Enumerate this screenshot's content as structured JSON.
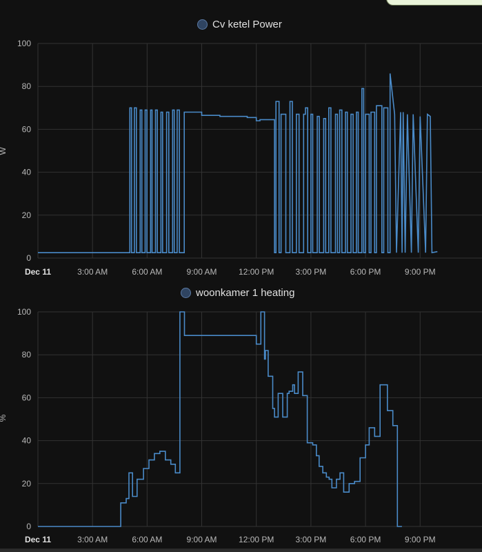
{
  "charts": [
    {
      "type": "line",
      "legend": "Cv ketel Power",
      "ylabel": "W",
      "ylim": [
        0,
        100
      ],
      "yticks": [
        "0",
        "20",
        "40",
        "60",
        "80",
        "100"
      ],
      "xlim": [
        0,
        24.4
      ],
      "xticks": [
        {
          "x": 0,
          "label": "Dec 11",
          "bold": true
        },
        {
          "x": 3,
          "label": "3:00 AM"
        },
        {
          "x": 6,
          "label": "6:00 AM"
        },
        {
          "x": 9,
          "label": "9:00 AM"
        },
        {
          "x": 12,
          "label": "12:00 PM"
        },
        {
          "x": 15,
          "label": "3:00 PM"
        },
        {
          "x": 18,
          "label": "6:00 PM"
        },
        {
          "x": 21,
          "label": "9:00 PM"
        }
      ],
      "color": "#4a8bc9",
      "series": {
        "x": [
          0.0,
          5.05,
          5.05,
          5.14,
          5.14,
          5.3,
          5.3,
          5.41,
          5.41,
          5.62,
          5.62,
          5.71,
          5.71,
          5.89,
          5.89,
          5.99,
          5.99,
          6.19,
          6.19,
          6.27,
          6.27,
          6.46,
          6.46,
          6.56,
          6.56,
          6.76,
          6.76,
          6.85,
          6.85,
          7.07,
          7.07,
          7.19,
          7.19,
          7.4,
          7.4,
          7.49,
          7.49,
          7.65,
          7.65,
          7.77,
          7.77,
          8.04,
          8.04,
          9.0,
          9.0,
          10.0,
          10.0,
          11.5,
          11.5,
          12.0,
          12.0,
          12.2,
          12.2,
          13.0,
          13.0,
          13.08,
          13.08,
          13.25,
          13.25,
          13.36,
          13.36,
          13.62,
          13.62,
          13.85,
          13.85,
          13.98,
          13.98,
          14.2,
          14.2,
          14.35,
          14.35,
          14.6,
          14.6,
          14.7,
          14.7,
          14.82,
          14.82,
          15.0,
          15.0,
          15.1,
          15.1,
          15.35,
          15.35,
          15.46,
          15.46,
          15.7,
          15.7,
          15.81,
          15.81,
          15.98,
          15.98,
          16.1,
          16.1,
          16.35,
          16.35,
          16.46,
          16.46,
          16.58,
          16.58,
          16.7,
          16.7,
          16.9,
          16.9,
          17.0,
          17.0,
          17.2,
          17.2,
          17.32,
          17.32,
          17.5,
          17.5,
          17.6,
          17.6,
          17.8,
          17.8,
          17.9,
          17.9,
          18.0,
          18.0,
          18.2,
          18.2,
          18.3,
          18.3,
          18.5,
          18.5,
          18.6,
          18.6,
          18.9,
          18.9,
          19.0,
          19.0,
          19.23,
          19.23,
          19.35,
          19.35,
          19.6,
          19.6,
          19.7,
          19.7,
          19.93,
          19.93,
          20.01,
          20.01,
          20.07,
          20.07,
          20.18,
          20.18,
          20.3,
          20.3,
          20.52,
          20.52,
          20.62,
          20.62,
          20.9,
          20.9,
          21.0,
          21.0,
          21.3,
          21.3,
          21.4,
          21.4,
          21.56,
          21.56,
          21.65,
          21.65,
          21.95,
          21.95,
          22.05,
          22.05,
          22.2,
          22.2,
          22.95,
          22.95,
          24.4
        ],
        "y": [
          2.5,
          2.5,
          70,
          70,
          2.5,
          2.5,
          70,
          70,
          2.5,
          2.5,
          69,
          69,
          2.5,
          2.5,
          69,
          69,
          2.5,
          2.5,
          69,
          69,
          2.5,
          2.5,
          69,
          69,
          2.5,
          2.5,
          68,
          68,
          2.5,
          2.5,
          68,
          68,
          2.5,
          2.5,
          69,
          69,
          2.5,
          2.5,
          69,
          69,
          2.5,
          2.5,
          68,
          68,
          66.5,
          66.5,
          66,
          66,
          65.5,
          65.5,
          64,
          64,
          64.5,
          64.5,
          2.5,
          2.5,
          73,
          73,
          2.5,
          2.5,
          67,
          67,
          2.5,
          2.5,
          73,
          73,
          2.5,
          2.5,
          67,
          67,
          2.5,
          2.5,
          67,
          67,
          70,
          70,
          2.5,
          2.5,
          67,
          67,
          2.5,
          2.5,
          66,
          66,
          2.5,
          2.5,
          65,
          65,
          2.5,
          2.5,
          70,
          70,
          2.5,
          2.5,
          67,
          67,
          2.5,
          2.5,
          69,
          69,
          2.5,
          2.5,
          68,
          68,
          2.5,
          2.5,
          67,
          67,
          2.5,
          2.5,
          68,
          68,
          2.5,
          2.5,
          79,
          79,
          2.5,
          2.5,
          67,
          67,
          2.5,
          2.5,
          68,
          68,
          2.5,
          2.5,
          71,
          71,
          2.5,
          2.5,
          70,
          70,
          2.5,
          2.5,
          86,
          67,
          67,
          2.5,
          2.5,
          68,
          68,
          2.5,
          2.5,
          68,
          68,
          2.5,
          2.5,
          67,
          67,
          2.5,
          2.5,
          67,
          67,
          2.5,
          2.5,
          66,
          66,
          2.5,
          2.5,
          67,
          67,
          66,
          66,
          2.5,
          2.5,
          3,
          3
        ]
      }
    },
    {
      "type": "line",
      "legend": "woonkamer 1 heating",
      "ylabel": "%",
      "ylim": [
        0,
        100
      ],
      "yticks": [
        "0",
        "20",
        "40",
        "60",
        "80",
        "100"
      ],
      "xlim": [
        0,
        24.4
      ],
      "xticks": [
        {
          "x": 0,
          "label": "Dec 11",
          "bold": true
        },
        {
          "x": 3,
          "label": "3:00 AM"
        },
        {
          "x": 6,
          "label": "6:00 AM"
        },
        {
          "x": 9,
          "label": "9:00 AM"
        },
        {
          "x": 12,
          "label": "12:00 PM"
        },
        {
          "x": 15,
          "label": "3:00 PM"
        },
        {
          "x": 18,
          "label": "6:00 PM"
        },
        {
          "x": 21,
          "label": "9:00 PM"
        }
      ],
      "color": "#4a8bc9",
      "series": {
        "x": [
          0.0,
          4.55,
          4.55,
          4.85,
          4.85,
          5.0,
          5.0,
          5.2,
          5.2,
          5.45,
          5.45,
          5.8,
          5.8,
          6.1,
          6.1,
          6.4,
          6.4,
          6.7,
          6.7,
          7.0,
          7.0,
          7.3,
          7.3,
          7.55,
          7.55,
          7.8,
          7.8,
          8.05,
          8.05,
          12.0,
          12.0,
          12.25,
          12.25,
          12.45,
          12.45,
          12.5,
          12.5,
          12.65,
          12.65,
          12.9,
          12.9,
          13.0,
          13.0,
          13.2,
          13.2,
          13.45,
          13.45,
          13.7,
          13.7,
          13.8,
          13.8,
          14.0,
          14.0,
          14.1,
          14.1,
          14.3,
          14.3,
          14.55,
          14.55,
          14.8,
          14.8,
          15.1,
          15.1,
          15.3,
          15.3,
          15.45,
          15.45,
          15.65,
          15.65,
          15.85,
          15.85,
          16.0,
          16.0,
          16.15,
          16.15,
          16.4,
          16.4,
          16.6,
          16.6,
          16.8,
          16.8,
          17.1,
          17.1,
          17.4,
          17.4,
          17.7,
          17.7,
          18.0,
          18.0,
          18.2,
          18.2,
          18.5,
          18.5,
          18.8,
          18.8,
          19.2,
          19.2,
          19.5,
          19.5,
          19.75,
          19.75,
          20.0,
          20.0,
          20.4,
          20.4,
          20.7,
          20.7,
          20.9,
          20.9,
          21.1,
          21.1,
          21.25,
          21.25,
          21.4,
          21.4,
          21.65,
          21.65,
          22.0,
          22.0,
          24.4
        ],
        "y": [
          0,
          0,
          11,
          11,
          13,
          13,
          25,
          25,
          14,
          14,
          22,
          22,
          27,
          27,
          31,
          31,
          34,
          34,
          35,
          35,
          31,
          31,
          29,
          29,
          25,
          25,
          100,
          100,
          89,
          89,
          85,
          85,
          100,
          100,
          78,
          78,
          82,
          82,
          70,
          70,
          55,
          55,
          51,
          51,
          62,
          62,
          51,
          51,
          62,
          62,
          63,
          63,
          66,
          66,
          62,
          62,
          72,
          72,
          61,
          61,
          39,
          39,
          38,
          38,
          33,
          33,
          28,
          28,
          25,
          25,
          23,
          23,
          22,
          22,
          18,
          18,
          22,
          22,
          25,
          25,
          16,
          16,
          20,
          20,
          21,
          21,
          32,
          32,
          38,
          38,
          46,
          46,
          42,
          42,
          66,
          66,
          54,
          54,
          47,
          47,
          0,
          0
        ]
      }
    }
  ]
}
